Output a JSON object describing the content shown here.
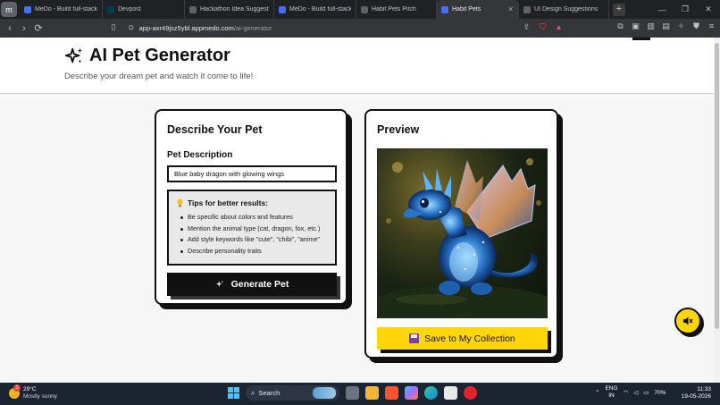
{
  "browser": {
    "profile_initial": "m",
    "tabs": [
      {
        "label": "MeDo - Build full-stack A",
        "icon": "medo-icon",
        "color": "#4a6cf7"
      },
      {
        "label": "Devpost",
        "icon": "devpost-icon",
        "color": "#003e54"
      },
      {
        "label": "Hackathon Idea Suggesti",
        "icon": "chatgpt-icon",
        "color": "#5f6368"
      },
      {
        "label": "MeDo - Build full-stack A",
        "icon": "medo-icon",
        "color": "#4a6cf7"
      },
      {
        "label": "Habit Pets Pitch",
        "icon": "chatgpt-icon",
        "color": "#5f6368"
      },
      {
        "label": "Habit Pets",
        "icon": "medo-icon",
        "color": "#4a6cf7",
        "active": true
      },
      {
        "label": "UI Design Suggestions",
        "icon": "chatgpt-icon",
        "color": "#5f6368"
      }
    ],
    "url_host": "app-axr49jsz5ybl.appmedo.com",
    "url_path": "/ai-generator"
  },
  "page": {
    "title": "AI Pet Generator",
    "subtitle": "Describe your dream pet and watch it come to life!",
    "describe_card": {
      "title": "Describe Your Pet",
      "field_label": "Pet Description",
      "field_value": "Blue baby dragon with glowing wings",
      "tips_title": "Tips for better results:",
      "tips": [
        "Be specific about colors and features",
        "Mention the animal type (cat, dragon, fox, etc.)",
        "Add style keywords like \"cute\", \"chibi\", \"anime\"",
        "Describe personality traits"
      ],
      "generate_label": "Generate Pet"
    },
    "preview_card": {
      "title": "Preview",
      "save_label": "Save to My Collection"
    },
    "colors": {
      "accent_yellow": "#ffd60a",
      "ink": "#111111"
    }
  },
  "taskbar": {
    "weather_badge": "1",
    "temperature": "29°C",
    "condition": "Mostly sunny",
    "search_label": "Search",
    "lang_top": "ENG",
    "lang_bottom": "IN",
    "battery": "70%",
    "time": "11:33",
    "date": "19-05-2026"
  }
}
